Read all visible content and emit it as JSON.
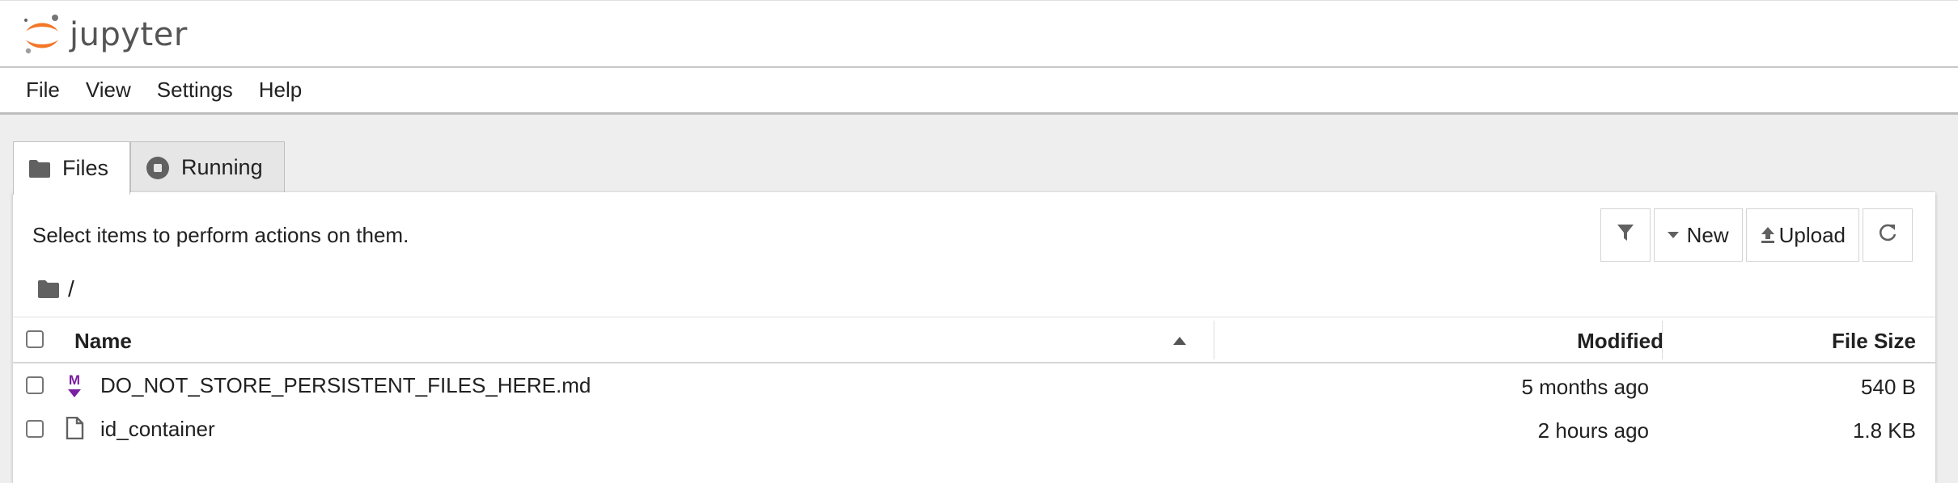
{
  "app": {
    "logo_text": "jupyter"
  },
  "menu": [
    "File",
    "View",
    "Settings",
    "Help"
  ],
  "tabs": [
    {
      "label": "Files",
      "icon": "folder-icon",
      "active": true
    },
    {
      "label": "Running",
      "icon": "stop-circle-icon",
      "active": false
    }
  ],
  "panel": {
    "hint": "Select items to perform actions on them.",
    "toolbar": {
      "filter_icon": "filter-icon",
      "new_label": "New",
      "upload_label": "Upload",
      "refresh_icon": "refresh-icon"
    },
    "breadcrumb": {
      "icon": "folder-icon",
      "path": "/"
    }
  },
  "table": {
    "headers": {
      "name": "Name",
      "modified": "Modified",
      "size": "File Size"
    },
    "sort": {
      "column": "name",
      "direction": "ascending"
    },
    "rows": [
      {
        "name": "DO_NOT_STORE_PERSISTENT_FILES_HERE.md",
        "icon": "markdown-icon",
        "modified": "5 months ago",
        "size": "540 B"
      },
      {
        "name": "id_container",
        "icon": "file-icon",
        "modified": "2 hours ago",
        "size": "1.8 KB"
      }
    ]
  },
  "colors": {
    "jupyter_orange": "#f37726",
    "markdown_purple": "#7b1fa2",
    "icon_gray": "#616161"
  }
}
